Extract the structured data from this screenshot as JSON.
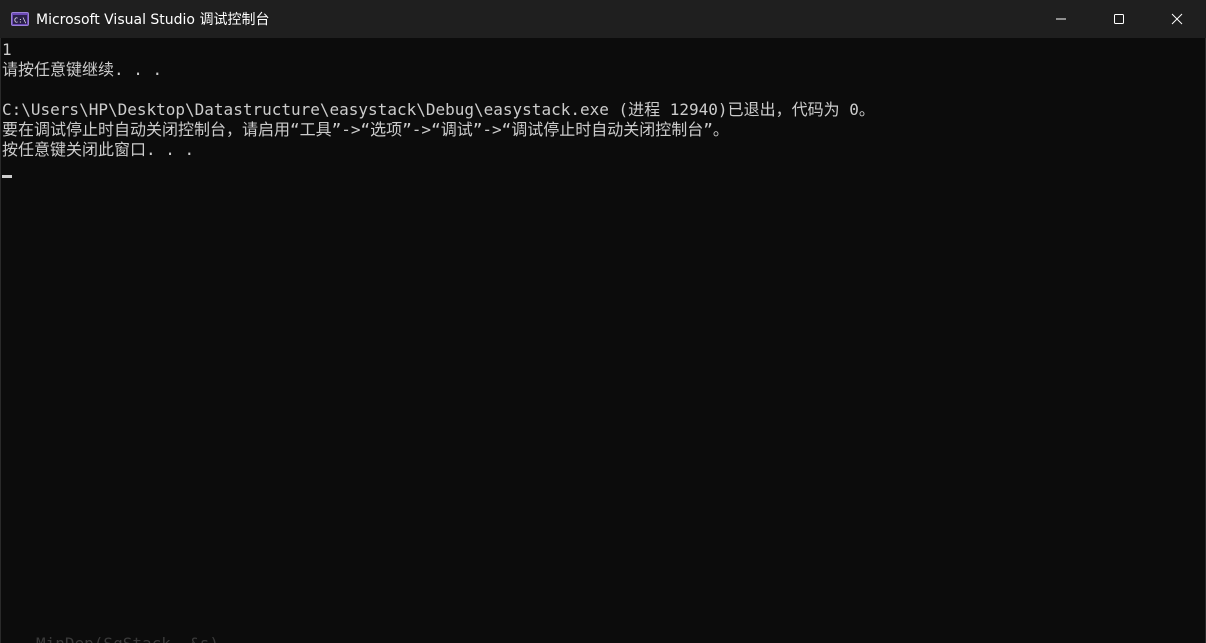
{
  "window": {
    "title": "Microsoft Visual Studio 调试控制台"
  },
  "icons": {
    "app": "console-app-icon",
    "minimize": "minimize-icon",
    "maximize": "maximize-icon",
    "close": "close-icon"
  },
  "colors": {
    "titlebar_bg": "#1f1f1f",
    "console_bg": "#0c0c0c",
    "console_text": "#cccccc",
    "icon_accent": "#6c4ab6"
  },
  "console": {
    "lines": [
      "1",
      "请按任意键继续. . .",
      "",
      "C:\\Users\\HP\\Desktop\\Datastructure\\easystack\\Debug\\easystack.exe (进程 12940)已退出，代码为 0。",
      "要在调试停止时自动关闭控制台，请启用“工具”->“选项”->“调试”->“调试停止时自动关闭控制台”。",
      "按任意键关闭此窗口. . ."
    ],
    "background_text": "MinDep(SqStack, &s)"
  }
}
